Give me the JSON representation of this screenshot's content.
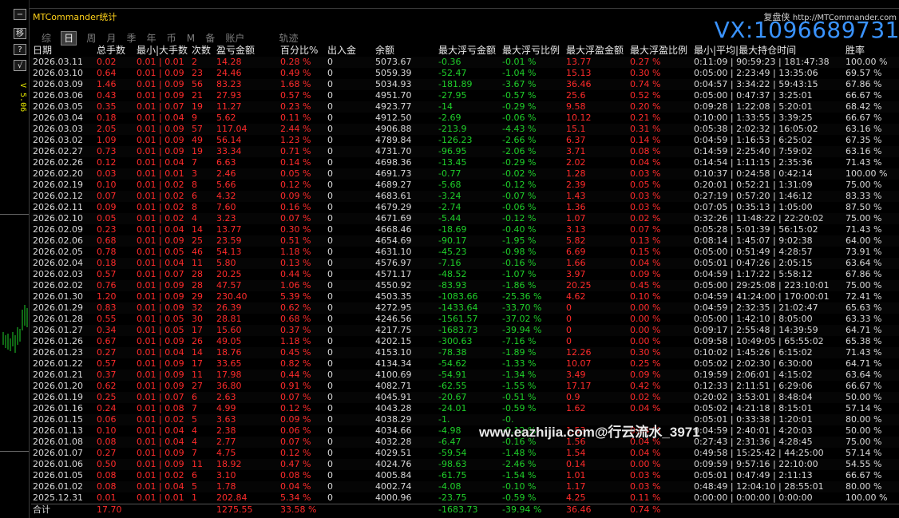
{
  "window_title": "MTCommander统计",
  "left_buttons": {
    "minimize": "−",
    "move": "移",
    "help": "?",
    "check": "√"
  },
  "version": "V 5.06",
  "tabs": [
    {
      "label": "综",
      "selected": false
    },
    {
      "label": "日",
      "selected": true
    },
    {
      "label": "周",
      "selected": false
    },
    {
      "label": "月",
      "selected": false
    },
    {
      "label": "季",
      "selected": false
    },
    {
      "label": "年",
      "selected": false
    },
    {
      "label": "币",
      "selected": false
    },
    {
      "label": "M",
      "selected": false
    },
    {
      "label": "备",
      "selected": false
    },
    {
      "label": "账户",
      "selected": false
    },
    {
      "label": "轨迹",
      "selected": false
    }
  ],
  "site_label": "复盘侠",
  "site_url": "http://MTCommander.com",
  "contact_overlay": "VX:1096689731",
  "watermark": "www.eazhijia.com@行云流水_3971",
  "columns": [
    "日期",
    "总手数",
    "最小|大手数",
    "次数",
    "盈亏金额",
    "百分比%",
    "出入金",
    "余额",
    "最大浮亏金额",
    "最大浮亏比例",
    "最大浮盈金额",
    "最大浮盈比例",
    "最小|平均|最大持仓时间",
    "胜率"
  ],
  "rows": [
    [
      "2026.03.11",
      "0.02",
      "0.01 | 0.01",
      "2",
      "14.28",
      "0.28 %",
      "0",
      "5073.67",
      "-0.36",
      "-0.01 %",
      "13.77",
      "0.27 %",
      "0:11:09 | 90:59:23 | 181:47:38",
      "100.00 %"
    ],
    [
      "2026.03.10",
      "0.64",
      "0.01 | 0.09",
      "23",
      "24.46",
      "0.49 %",
      "0",
      "5059.39",
      "-52.47",
      "-1.04 %",
      "15.13",
      "0.30 %",
      "0:05:00 | 2:23:49 | 13:35:06",
      "69.57 %"
    ],
    [
      "2026.03.09",
      "1.46",
      "0.01 | 0.09",
      "56",
      "83.23",
      "1.68 %",
      "0",
      "5034.93",
      "-181.89",
      "-3.67 %",
      "36.46",
      "0.74 %",
      "0:04:57 | 3:34:22 | 59:43:15",
      "67.86 %"
    ],
    [
      "2026.03.06",
      "0.43",
      "0.01 | 0.09",
      "21",
      "27.93",
      "0.57 %",
      "0",
      "4951.70",
      "-27.95",
      "-0.57 %",
      "25.6",
      "0.52 %",
      "0:05:00 | 0:47:37 | 3:25:01",
      "66.67 %"
    ],
    [
      "2026.03.05",
      "0.35",
      "0.01 | 0.07",
      "19",
      "11.27",
      "0.23 %",
      "0",
      "4923.77",
      "-14",
      "-0.29 %",
      "9.58",
      "0.20 %",
      "0:09:28 | 1:22:08 | 5:20:01",
      "68.42 %"
    ],
    [
      "2026.03.04",
      "0.18",
      "0.01 | 0.04",
      "9",
      "5.62",
      "0.11 %",
      "0",
      "4912.50",
      "-2.69",
      "-0.06 %",
      "10.12",
      "0.21 %",
      "0:10:00 | 1:33:55 | 3:39:25",
      "66.67 %"
    ],
    [
      "2026.03.03",
      "2.05",
      "0.01 | 0.09",
      "57",
      "117.04",
      "2.44 %",
      "0",
      "4906.88",
      "-213.9",
      "-4.43 %",
      "15.1",
      "0.31 %",
      "0:05:38 | 2:02:32 | 16:05:02",
      "63.16 %"
    ],
    [
      "2026.03.02",
      "1.09",
      "0.01 | 0.09",
      "49",
      "56.14",
      "1.23 %",
      "0",
      "4789.84",
      "-126.23",
      "-2.66 %",
      "6.37",
      "0.14 %",
      "0:04:59 | 1:16:53 | 6:25:02",
      "67.35 %"
    ],
    [
      "2026.02.27",
      "0.73",
      "0.01 | 0.09",
      "19",
      "33.34",
      "0.71 %",
      "0",
      "4731.70",
      "-96.95",
      "-2.06 %",
      "3.71",
      "0.08 %",
      "0:14:59 | 2:25:40 | 7:59:02",
      "63.16 %"
    ],
    [
      "2026.02.26",
      "0.12",
      "0.01 | 0.04",
      "7",
      "6.63",
      "0.14 %",
      "0",
      "4698.36",
      "-13.45",
      "-0.29 %",
      "2.02",
      "0.04 %",
      "0:14:54 | 1:11:15 | 2:35:36",
      "71.43 %"
    ],
    [
      "2026.02.20",
      "0.03",
      "0.01 | 0.01",
      "3",
      "2.46",
      "0.05 %",
      "0",
      "4691.73",
      "-0.77",
      "-0.02 %",
      "1.28",
      "0.03 %",
      "0:10:37 | 0:24:58 | 0:42:14",
      "100.00 %"
    ],
    [
      "2026.02.19",
      "0.10",
      "0.01 | 0.02",
      "8",
      "5.66",
      "0.12 %",
      "0",
      "4689.27",
      "-5.68",
      "-0.12 %",
      "2.39",
      "0.05 %",
      "0:20:01 | 0:52:21 | 1:31:09",
      "75.00 %"
    ],
    [
      "2026.02.12",
      "0.07",
      "0.01 | 0.02",
      "6",
      "4.32",
      "0.09 %",
      "0",
      "4683.61",
      "-3.24",
      "-0.07 %",
      "1.43",
      "0.03 %",
      "0:27:19 | 0:57:20 | 1:46:12",
      "83.33 %"
    ],
    [
      "2026.02.11",
      "0.09",
      "0.01 | 0.02",
      "8",
      "7.60",
      "0.16 %",
      "0",
      "4679.29",
      "-2.74",
      "-0.06 %",
      "1.36",
      "0.03 %",
      "0:07:05 | 0:35:13 | 1:05:00",
      "87.50 %"
    ],
    [
      "2026.02.10",
      "0.05",
      "0.01 | 0.02",
      "4",
      "3.23",
      "0.07 %",
      "0",
      "4671.69",
      "-5.44",
      "-0.12 %",
      "1.07",
      "0.02 %",
      "0:32:26 | 11:48:22 | 22:20:02",
      "75.00 %"
    ],
    [
      "2026.02.09",
      "0.23",
      "0.01 | 0.04",
      "14",
      "13.77",
      "0.30 %",
      "0",
      "4668.46",
      "-18.69",
      "-0.40 %",
      "3.13",
      "0.07 %",
      "0:05:28 | 5:01:39 | 56:15:02",
      "71.43 %"
    ],
    [
      "2026.02.06",
      "0.68",
      "0.01 | 0.09",
      "25",
      "23.59",
      "0.51 %",
      "0",
      "4654.69",
      "-90.17",
      "-1.95 %",
      "5.82",
      "0.13 %",
      "0:08:14 | 1:45:07 | 9:02:38",
      "64.00 %"
    ],
    [
      "2026.02.05",
      "0.78",
      "0.01 | 0.05",
      "46",
      "54.13",
      "1.18 %",
      "0",
      "4631.10",
      "-45.23",
      "-0.98 %",
      "6.69",
      "0.15 %",
      "0:05:00 | 0:51:49 | 4:28:57",
      "73.91 %"
    ],
    [
      "2026.02.04",
      "0.18",
      "0.01 | 0.04",
      "11",
      "5.80",
      "0.13 %",
      "0",
      "4576.97",
      "-7.16",
      "-0.16 %",
      "1.66",
      "0.04 %",
      "0:05:01 | 0:47:26 | 2:05:15",
      "63.64 %"
    ],
    [
      "2026.02.03",
      "0.57",
      "0.01 | 0.07",
      "28",
      "20.25",
      "0.44 %",
      "0",
      "4571.17",
      "-48.52",
      "-1.07 %",
      "3.97",
      "0.09 %",
      "0:04:59 | 1:17:22 | 5:58:12",
      "67.86 %"
    ],
    [
      "2026.02.02",
      "0.76",
      "0.01 | 0.09",
      "28",
      "47.57",
      "1.06 %",
      "0",
      "4550.92",
      "-83.93",
      "-1.86 %",
      "20.25",
      "0.45 %",
      "0:05:00 | 29:25:08 | 223:10:01",
      "75.00 %"
    ],
    [
      "2026.01.30",
      "1.20",
      "0.01 | 0.09",
      "29",
      "230.40",
      "5.39 %",
      "0",
      "4503.35",
      "-1083.66",
      "-25.36 %",
      "4.62",
      "0.10 %",
      "0:04:59 | 41:24:00 | 170:00:01",
      "72.41 %"
    ],
    [
      "2026.01.29",
      "0.83",
      "0.01 | 0.09",
      "32",
      "26.39",
      "0.62 %",
      "0",
      "4272.95",
      "-1433.64",
      "-33.70 %",
      "0",
      "0.00 %",
      "0:04:59 | 2:32:35 | 21:02:47",
      "65.63 %"
    ],
    [
      "2026.01.28",
      "0.55",
      "0.01 | 0.05",
      "30",
      "28.81",
      "0.68 %",
      "0",
      "4246.56",
      "-1561.57",
      "-37.02 %",
      "0",
      "0.00 %",
      "0:05:00 | 1:42:10 | 8:05:00",
      "63.33 %"
    ],
    [
      "2026.01.27",
      "0.34",
      "0.01 | 0.05",
      "17",
      "15.60",
      "0.37 %",
      "0",
      "4217.75",
      "-1683.73",
      "-39.94 %",
      "0",
      "0.00 %",
      "0:09:17 | 2:55:48 | 14:39:59",
      "64.71 %"
    ],
    [
      "2026.01.26",
      "0.67",
      "0.01 | 0.09",
      "26",
      "49.05",
      "1.18 %",
      "0",
      "4202.15",
      "-300.63",
      "-7.16 %",
      "0",
      "0.00 %",
      "0:09:58 | 10:49:05 | 65:55:02",
      "65.38 %"
    ],
    [
      "2026.01.23",
      "0.27",
      "0.01 | 0.04",
      "14",
      "18.76",
      "0.45 %",
      "0",
      "4153.10",
      "-78.38",
      "-1.89 %",
      "12.26",
      "0.30 %",
      "0:10:02 | 1:45:26 | 6:15:02",
      "71.43 %"
    ],
    [
      "2026.01.22",
      "0.57",
      "0.01 | 0.09",
      "17",
      "33.65",
      "0.82 %",
      "0",
      "4134.34",
      "-54.62",
      "-1.33 %",
      "10.07",
      "0.25 %",
      "0:05:02 | 2:02:30 | 6:30:00",
      "64.71 %"
    ],
    [
      "2026.01.21",
      "0.37",
      "0.01 | 0.09",
      "11",
      "17.98",
      "0.44 %",
      "0",
      "4100.69",
      "-54.91",
      "-1.34 %",
      "3.49",
      "0.09 %",
      "0:19:59 | 2:06:01 | 4:15:02",
      "63.64 %"
    ],
    [
      "2026.01.20",
      "0.62",
      "0.01 | 0.09",
      "27",
      "36.80",
      "0.91 %",
      "0",
      "4082.71",
      "-62.55",
      "-1.55 %",
      "17.17",
      "0.42 %",
      "0:12:33 | 2:11:51 | 6:29:06",
      "66.67 %"
    ],
    [
      "2026.01.19",
      "0.25",
      "0.01 | 0.07",
      "6",
      "2.63",
      "0.07 %",
      "0",
      "4045.91",
      "-20.67",
      "-0.51 %",
      "0.9",
      "0.02 %",
      "0:20:02 | 3:53:01 | 8:48:04",
      "50.00 %"
    ],
    [
      "2026.01.16",
      "0.24",
      "0.01 | 0.08",
      "7",
      "4.99",
      "0.12 %",
      "0",
      "4043.28",
      "-24.01",
      "-0.59 %",
      "1.62",
      "0.04 %",
      "0:05:02 | 4:21:18 | 8:15:01",
      "57.14 %"
    ],
    [
      "2026.01.15",
      "0.06",
      "0.01 | 0.02",
      "5",
      "3.63",
      "0.09 %",
      "0",
      "4038.29",
      "-1.",
      "-0.",
      "",
      "",
      "0:05:01 | 0:33:38 | 1:20:01",
      "80.00 %"
    ],
    [
      "2026.01.13",
      "0.10",
      "0.01 | 0.04",
      "4",
      "2.38",
      "0.06 %",
      "0",
      "4034.66",
      "-4.98",
      "-0.12 %",
      "1.53",
      "0.04 %",
      "0:04:59 | 2:40:01 | 4:20:03",
      "50.00 %"
    ],
    [
      "2026.01.08",
      "0.08",
      "0.01 | 0.04",
      "4",
      "2.77",
      "0.07 %",
      "0",
      "4032.28",
      "-6.47",
      "-0.16 %",
      "1.56",
      "0.04 %",
      "0:27:43 | 2:31:36 | 4:28:45",
      "75.00 %"
    ],
    [
      "2026.01.07",
      "0.27",
      "0.01 | 0.09",
      "7",
      "4.75",
      "0.12 %",
      "0",
      "4029.51",
      "-59.54",
      "-1.48 %",
      "1.54",
      "0.04 %",
      "0:49:58 | 15:25:42 | 44:25:00",
      "57.14 %"
    ],
    [
      "2026.01.06",
      "0.50",
      "0.01 | 0.09",
      "11",
      "18.92",
      "0.47 %",
      "0",
      "4024.76",
      "-98.63",
      "-2.46 %",
      "0.14",
      "0.00 %",
      "0:09:59 | 9:57:16 | 22:10:00",
      "54.55 %"
    ],
    [
      "2026.01.05",
      "0.08",
      "0.01 | 0.02",
      "6",
      "3.10",
      "0.08 %",
      "0",
      "4005.84",
      "-61.75",
      "-1.54 %",
      "1.01",
      "0.03 %",
      "0:05:01 | 0:47:49 | 2:11:13",
      "66.67 %"
    ],
    [
      "2026.01.02",
      "0.08",
      "0.01 | 0.04",
      "5",
      "1.78",
      "0.04 %",
      "0",
      "4002.74",
      "-4.08",
      "-0.10 %",
      "1.17",
      "0.03 %",
      "0:48:49 | 12:04:10 | 28:55:01",
      "80.00 %"
    ],
    [
      "2025.12.31",
      "0.01",
      "0.01 | 0.01",
      "1",
      "202.84",
      "5.34 %",
      "0",
      "4000.96",
      "-23.75",
      "-0.59 %",
      "4.25",
      "0.11 %",
      "0:00:00 | 0:00:00 | 0:00:00",
      "100.00 %"
    ]
  ],
  "total": [
    "合计",
    "17.70",
    "",
    "",
    "1275.55",
    "33.58 %",
    "",
    "",
    "-1683.73",
    "-39.94 %",
    "36.46",
    "0.74 %",
    "",
    ""
  ],
  "colors": {
    "loss": "#1fd02a",
    "profit": "#ff2b2b",
    "title": "#ffd21a",
    "overlay": "#3a93ff"
  }
}
